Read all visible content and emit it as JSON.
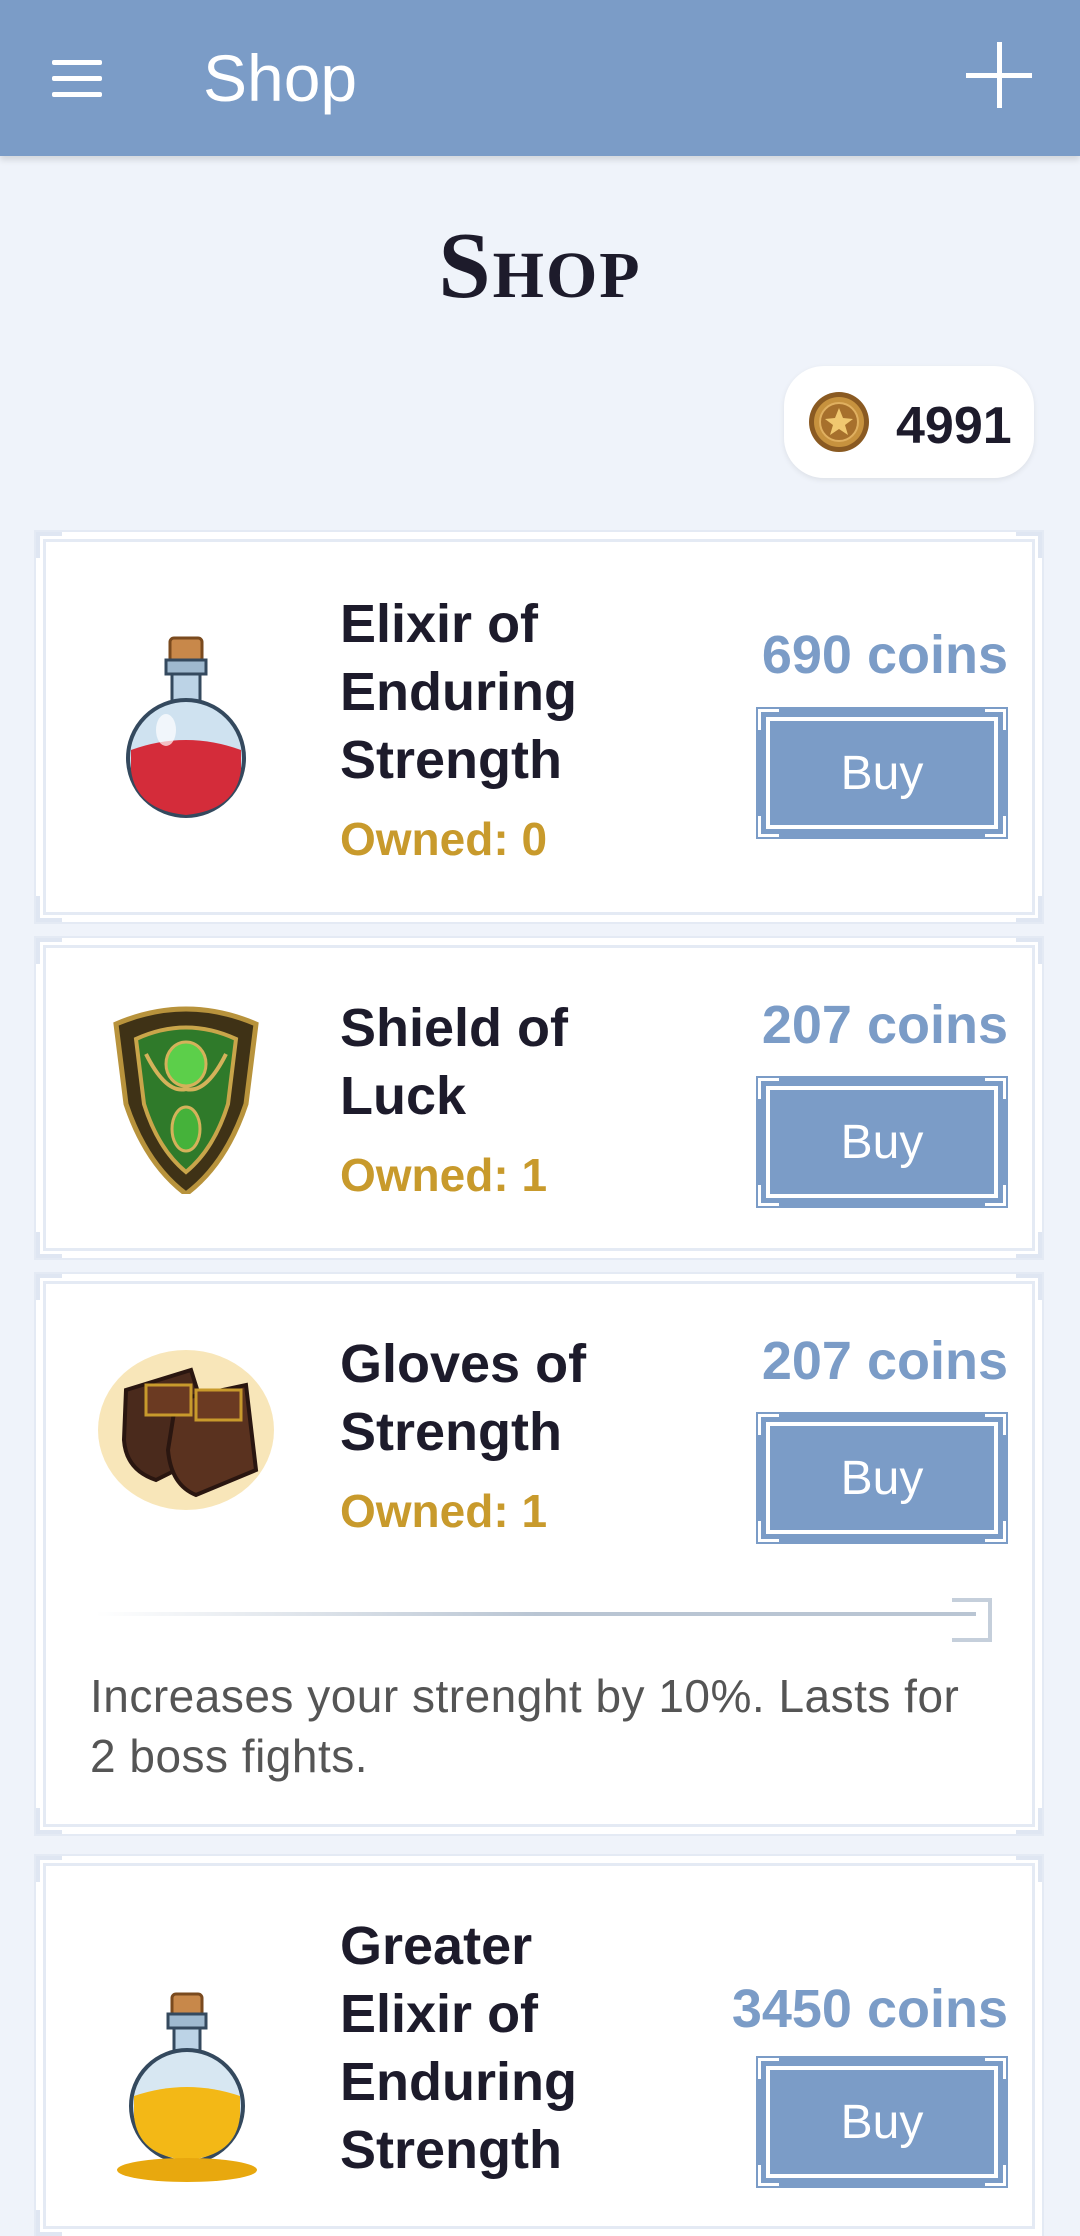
{
  "appbar": {
    "title": "Shop"
  },
  "heading": "Shop",
  "balance": {
    "value": "4991"
  },
  "items": [
    {
      "name": "Elixir of Enduring Strength",
      "owned": "Owned: 0",
      "price": "690 coins",
      "buy": "Buy",
      "icon": "red-potion-icon"
    },
    {
      "name": "Shield of Luck",
      "owned": "Owned: 1",
      "price": "207 coins",
      "buy": "Buy",
      "icon": "shield-icon"
    },
    {
      "name": "Gloves of Strength",
      "owned": "Owned: 1",
      "price": "207 coins",
      "buy": "Buy",
      "icon": "gloves-icon",
      "description": "Increases your strenght by 10%. Lasts for 2 boss fights."
    },
    {
      "name": "Greater Elixir of Enduring Strength",
      "owned": "",
      "price": "3450 coins",
      "buy": "Buy",
      "icon": "golden-potion-icon"
    }
  ],
  "colors": {
    "appbar": "#7b9cc7",
    "accent": "#7b9cc7",
    "owned": "#c89a2c",
    "background": "#eff3fa"
  }
}
